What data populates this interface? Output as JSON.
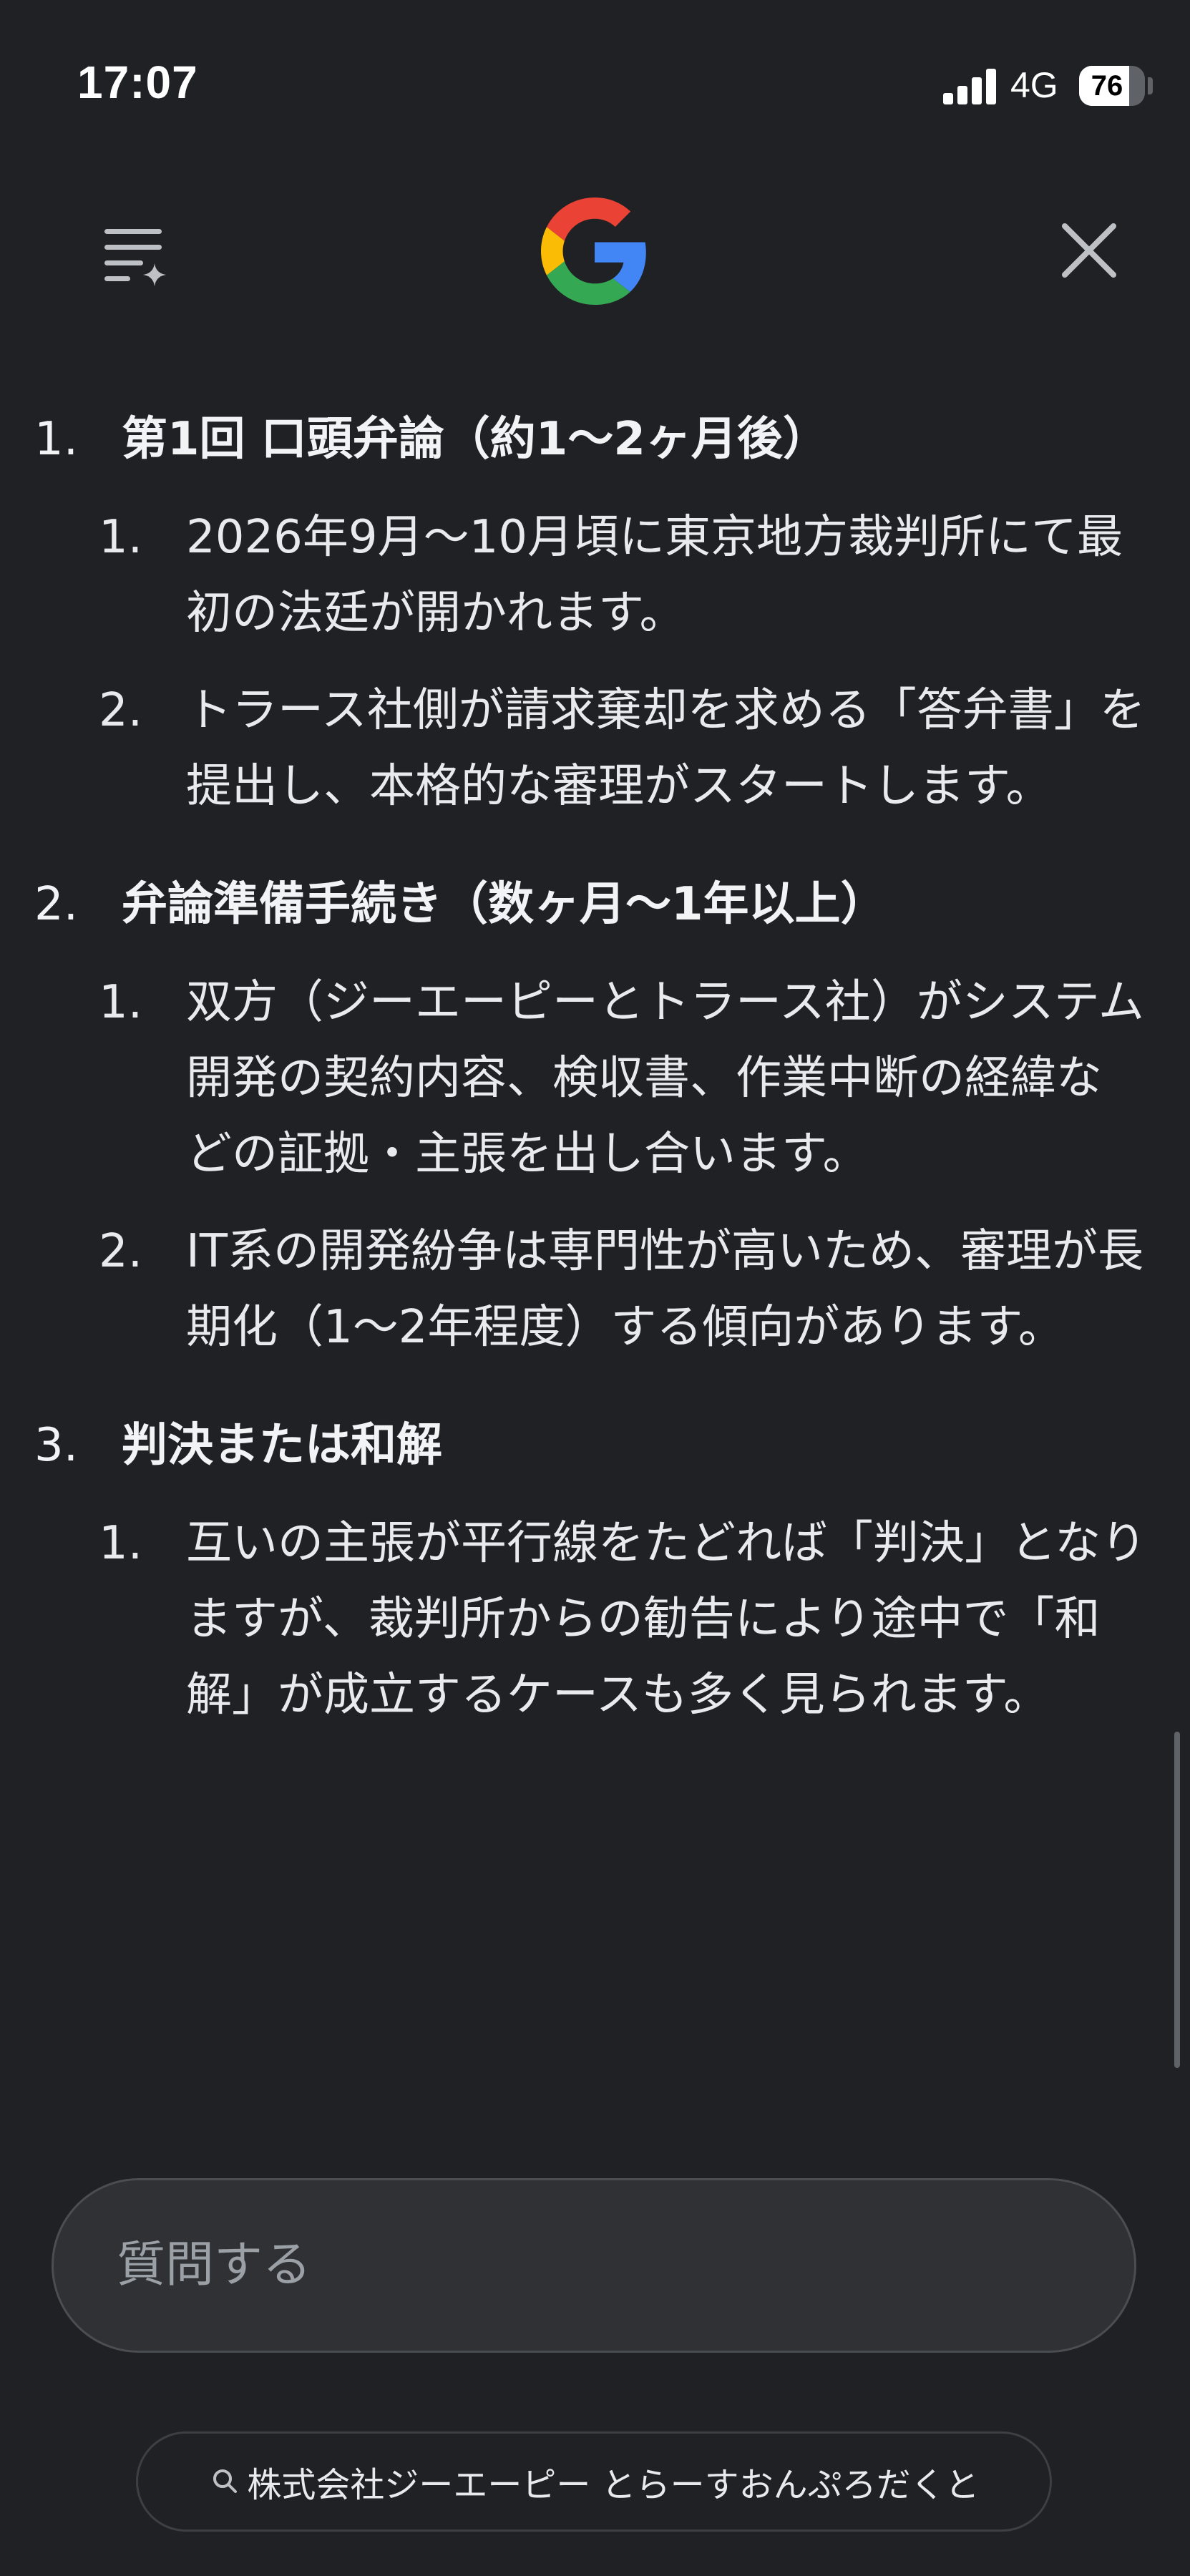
{
  "status_bar": {
    "time": "17:07",
    "network": "4G",
    "battery": "76",
    "battery_fraction": 0.76
  },
  "header": {
    "menu_icon": "list-sparkle-icon",
    "logo": "google-g-logo",
    "close_icon": "close-icon"
  },
  "content": {
    "sections": [
      {
        "number": "1.",
        "title": "第1回 口頭弁論（約1〜2ヶ月後）",
        "items": [
          {
            "number": "1.",
            "text": "2026年9月〜10月頃に東京地方裁判所にて最初の法廷が開かれます。"
          },
          {
            "number": "2.",
            "text": "トラース社側が請求棄却を求める「答弁書」を提出し、本格的な審理がスタートします。"
          }
        ]
      },
      {
        "number": "2.",
        "title": "弁論準備手続き（数ヶ月〜1年以上）",
        "items": [
          {
            "number": "1.",
            "text": "双方（ジーエーピーとトラース社）がシステム開発の契約内容、検収書、作業中断の経緯などの証拠・主張を出し合います。"
          },
          {
            "number": "2.",
            "text": "IT系の開発紛争は専門性が高いため、審理が長期化（1〜2年程度）する傾向があります。"
          }
        ]
      },
      {
        "number": "3.",
        "title": "判決または和解",
        "items": [
          {
            "number": "1.",
            "text": "互いの主張が平行線をたどれば「判決」となりますが、裁判所からの勧告により途中で「和解」が成立するケースも多く見られます。"
          }
        ]
      }
    ]
  },
  "ask": {
    "placeholder": "質問する"
  },
  "suggestion": {
    "icon": "search-icon",
    "text": "株式会社ジーエーピー とらーすおんぷろだくと"
  }
}
